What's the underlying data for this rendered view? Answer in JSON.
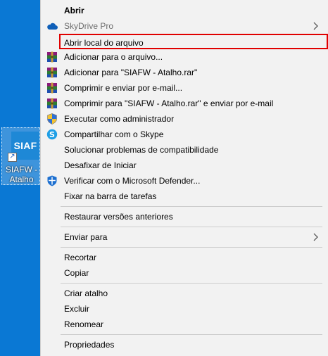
{
  "desktop": {
    "shortcut": {
      "tile_text": "SIAF",
      "label_line1": "SIAFW -",
      "label_line2": "Atalho"
    }
  },
  "context_menu": {
    "items": [
      {
        "label": "Abrir",
        "icon": null
      },
      {
        "label": "SkyDrive Pro",
        "icon": "cloud-icon",
        "submenu": true
      },
      {
        "label": "Abrir local do arquivo",
        "icon": null
      },
      {
        "label": "Adicionar para o arquivo...",
        "icon": "winrar-icon"
      },
      {
        "label": "Adicionar para \"SIAFW - Atalho.rar\"",
        "icon": "winrar-icon"
      },
      {
        "label": "Comprimir e enviar por e-mail...",
        "icon": "winrar-icon"
      },
      {
        "label": "Comprimir para \"SIAFW - Atalho.rar\" e enviar por e-mail",
        "icon": "winrar-icon"
      },
      {
        "label": "Executar como administrador",
        "icon": "uac-shield-icon"
      },
      {
        "label": "Compartilhar com o Skype",
        "icon": "skype-icon"
      },
      {
        "label": "Solucionar problemas de compatibilidade",
        "icon": null
      },
      {
        "label": "Desafixar de Iniciar",
        "icon": null
      },
      {
        "label": "Verificar com o Microsoft Defender...",
        "icon": "defender-icon"
      },
      {
        "label": "Fixar na barra de tarefas",
        "icon": null
      },
      {
        "label": "Restaurar versões anteriores",
        "icon": null
      },
      {
        "label": "Enviar para",
        "icon": null,
        "submenu": true
      },
      {
        "label": "Recortar",
        "icon": null
      },
      {
        "label": "Copiar",
        "icon": null
      },
      {
        "label": "Criar atalho",
        "icon": null
      },
      {
        "label": "Excluir",
        "icon": null
      },
      {
        "label": "Renomear",
        "icon": null
      },
      {
        "label": "Propriedades",
        "icon": null
      }
    ]
  },
  "colors": {
    "desktop_bg": "#0a78d4",
    "menu_bg": "#f2f2f2",
    "highlight_border": "#e00000",
    "disabled_text": "#6d6d6d"
  }
}
